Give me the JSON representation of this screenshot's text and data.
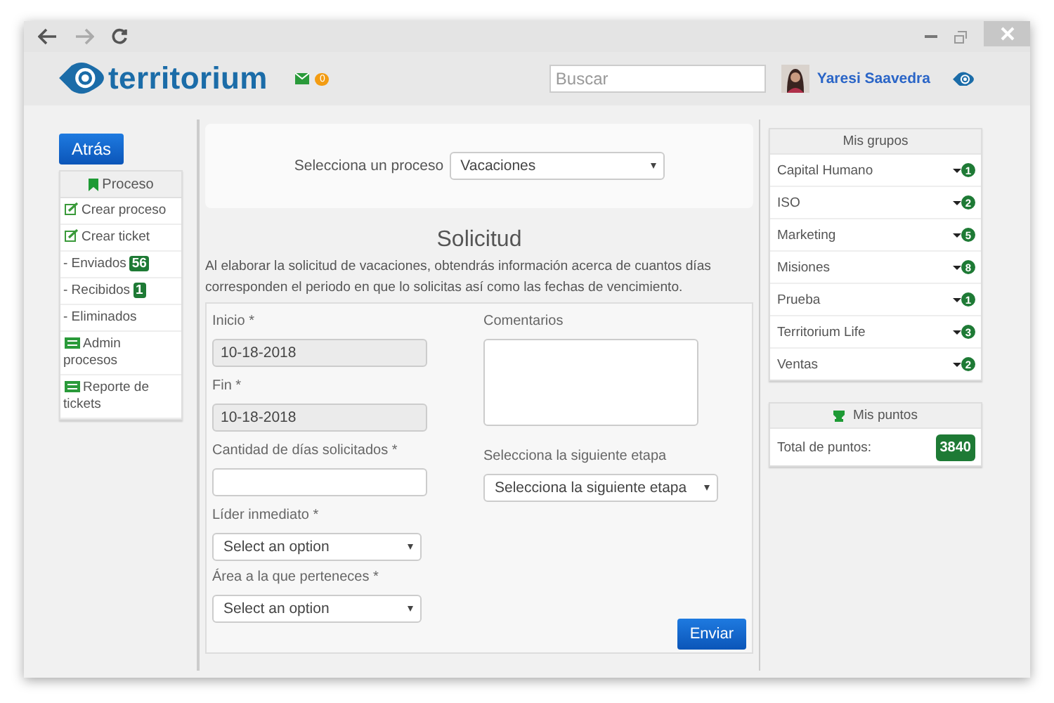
{
  "header": {
    "logo": "territorium",
    "mail_count": "0",
    "search": {
      "placeholder": "Buscar"
    },
    "user": "Yaresi Saavedra"
  },
  "back_button": "Atrás",
  "menu": {
    "title": "Proceso",
    "items": [
      {
        "label": "Crear proceso",
        "kind": "edit"
      },
      {
        "label": "Crear ticket",
        "kind": "edit"
      },
      {
        "label": "- Enviados",
        "kind": "plain",
        "badge": "56"
      },
      {
        "label": "- Recibidos",
        "kind": "plain",
        "badge": "1"
      },
      {
        "label": "- Eliminados",
        "kind": "plain"
      },
      {
        "label": "Admin procesos",
        "kind": "list"
      },
      {
        "label": "Reporte de tickets",
        "kind": "list"
      }
    ]
  },
  "process_select": {
    "label": "Selecciona un proceso",
    "value": "Vacaciones"
  },
  "form": {
    "title": "Solicitud",
    "description": "Al elaborar la solicitud de vacaciones, obtendrás información acerca de cuantos días corresponden el periodo en que lo solicitas así como las fechas de vencimiento.",
    "left_fields": [
      {
        "kind": "text",
        "label": "Inicio *",
        "value": "10-18-2018",
        "disabled": true
      },
      {
        "kind": "text",
        "label": "Fin *",
        "value": "10-18-2018",
        "disabled": true
      },
      {
        "kind": "text",
        "label": "Cantidad de días solicitados *",
        "disabled": false
      },
      {
        "kind": "select",
        "label": "Líder inmediato *",
        "value": "Select an option"
      },
      {
        "kind": "select",
        "label": "Área a la que perteneces *",
        "value": "Select an option"
      }
    ],
    "right_fields": [
      {
        "kind": "textarea",
        "label": "Comentarios"
      },
      {
        "kind": "select",
        "label": "Selecciona la siguiente etapa",
        "value": "Selecciona la siguiente etapa"
      }
    ],
    "submit": "Enviar"
  },
  "groups": {
    "title": "Mis grupos",
    "items": [
      {
        "name": "Capital Humano",
        "count": "1"
      },
      {
        "name": "ISO",
        "count": "2"
      },
      {
        "name": "Marketing",
        "count": "5"
      },
      {
        "name": "Misiones",
        "count": "8"
      },
      {
        "name": "Prueba",
        "count": "1"
      },
      {
        "name": "Territorium Life",
        "count": "3"
      },
      {
        "name": "Ventas",
        "count": "2"
      }
    ]
  },
  "points": {
    "title": "Mis puntos",
    "label": "Total de puntos:",
    "value": "3840"
  }
}
